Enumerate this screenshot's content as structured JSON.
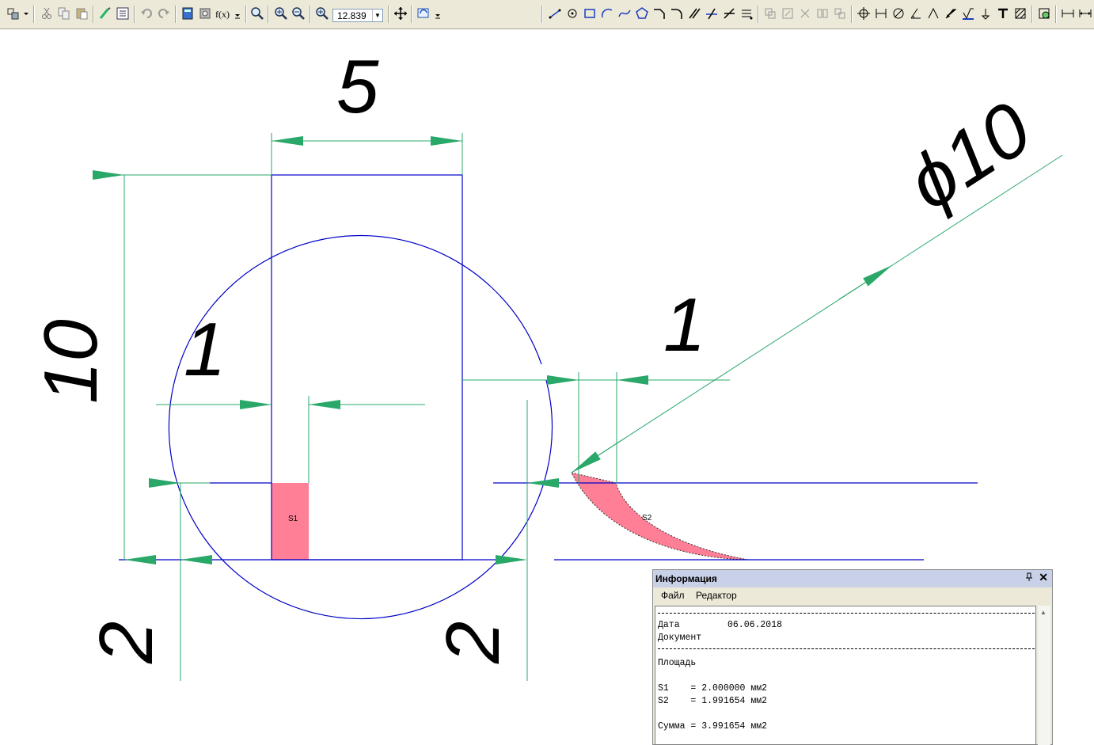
{
  "toolbar": {
    "zoom_value": "12.839",
    "fx_label": "f(x)"
  },
  "drawing": {
    "dim_rect_width": "5",
    "dim_rect_height": "10",
    "dim_small_left": "1",
    "dim_small_right": "1",
    "dim_left_two": "2",
    "dim_right_two": "2",
    "dim_diameter": "ϕ10",
    "label_s1": "S1",
    "label_s2": "S2",
    "colors": {
      "outline": "#0000c8",
      "dimension": "#2aa86a",
      "hatch": "#ff7f97",
      "text": "#000000"
    }
  },
  "info_panel": {
    "title": "Информация",
    "pin_icon": "pin-icon",
    "close_label": "✕",
    "menu": [
      "Файл",
      "Редактор"
    ],
    "date_label": "Дата",
    "date_value": "06.06.2018",
    "document_label": "Документ",
    "area_label": "Площадь",
    "s1_line": "S1    = 2.000000 мм2",
    "s2_line": "S2    = 1.991654 мм2",
    "sum_line": "Сумма = 3.991654 мм2"
  }
}
